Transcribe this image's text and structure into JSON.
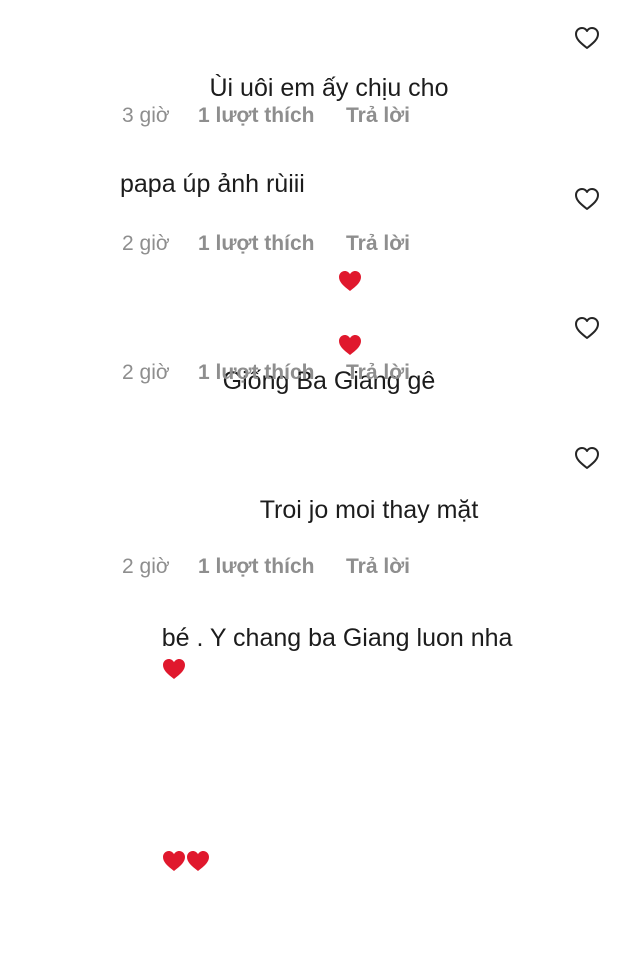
{
  "comments": [
    {
      "text_line1": "Ùi uôi em ấy chịu cho",
      "text_line2": "papa úp ảnh rùiii",
      "time": "3 giờ",
      "likes": "1 lượt thích",
      "reply": "Trả lời"
    },
    {
      "text": "❤️❤️",
      "time": "2 giờ",
      "likes": "1 lượt thích",
      "reply": "Trả lời"
    },
    {
      "text": "Giống Ba Giang gê",
      "time": "2 giờ",
      "likes": "1 lượt thích",
      "reply": "Trả lời"
    },
    {
      "text_line1": "Troi jo moi thay mặt",
      "text_line2": "bé . Y chang ba Giang luon nha",
      "text_line3": "❤️❤️❤️",
      "time": "2 giờ",
      "likes": "1 lượt thích",
      "reply": "Trả lời"
    }
  ],
  "icons": {
    "like": "heart-outline-icon",
    "emoji": "red-heart-emoji"
  },
  "colors": {
    "text": "#1c1c1c",
    "meta": "#8e8e8e",
    "heart_emoji": "#e0182d"
  }
}
